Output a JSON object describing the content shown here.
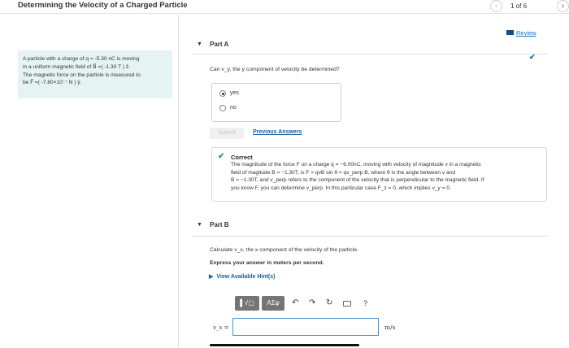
{
  "header": {
    "title": "Determining the Velocity of a Charged Particle",
    "counter": "1 of 6",
    "prev_icon": "chevron-left",
    "next_icon": "chevron-right"
  },
  "problem": {
    "line1": "A particle with a charge of q = -5.30 nC is moving",
    "line2": "in a uniform magnetic field of B⃗ =( -1.30 T ) ẑ.",
    "line3": "The magnetic force on the particle is measured to",
    "line4": "be F⃗ =( -7.60×10⁻⁷ N ) ŷ."
  },
  "review": {
    "label": "Review"
  },
  "partA": {
    "label": "Part A",
    "question": "Can v_y, the y component of velocity be determined?",
    "options": [
      "yes",
      "no"
    ],
    "selected": "yes",
    "submit_label": "Submit",
    "previous_answers_label": "Previous Answers",
    "feedback": {
      "title": "Correct",
      "line1": "The magnitude of the force F on a charge q = −6.00nC, moving with velocity of magnitude v in a magnetic",
      "line2": "field of magitude B = −1.30T, is F = qvB sin θ = qv_perp B, where θ is the angle between v and",
      "line3": "B = −1.30T, and v_perp refers to the component of the velocity that is perpendicular to the magnetic field. If",
      "line4": "you know F, you can determine v_perp. In this particular case F_z = 0, which implies v_y = 0."
    }
  },
  "partB": {
    "label": "Part B",
    "question": "Calculate v_x, the x component of the velocity of the particle.",
    "instruction": "Express your answer in meters per second.",
    "hint_label": "View Available Hint(s)",
    "toolbar": {
      "template_btn": "▌√▢",
      "symbol_btn": "ΑΣφ",
      "undo": "↶",
      "redo": "↷",
      "reset": "↻",
      "keyboard": "keyboard",
      "help": "?"
    },
    "answer_label": "v_x =",
    "answer_value": "",
    "unit": "m/s"
  },
  "colors": {
    "link": "#1a5fa0",
    "correct": "#2e9c4a",
    "problem_bg": "#e5f3f3"
  }
}
